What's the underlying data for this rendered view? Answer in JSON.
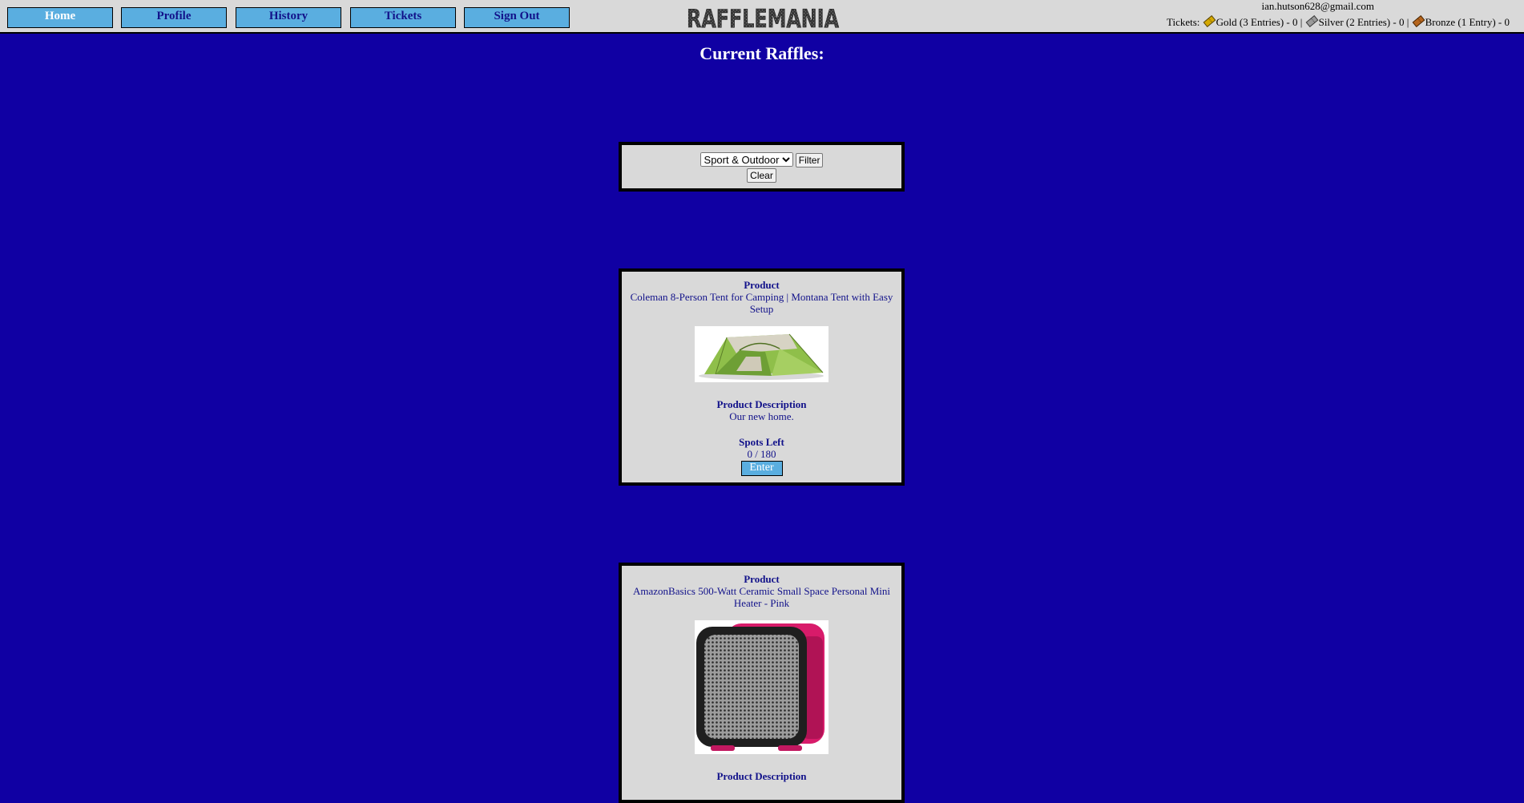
{
  "nav": {
    "home": "Home",
    "profile": "Profile",
    "history": "History",
    "tickets": "Tickets",
    "sign_out": "Sign Out"
  },
  "brand": {
    "logo_text": "RAFFLEMANIA"
  },
  "user": {
    "email": "ian.hutson628@gmail.com"
  },
  "tickets_bar": {
    "label": "Tickets:",
    "gold": "Gold (3 Entries) - 0",
    "silver": "Silver (2 Entries) - 0",
    "bronze": "Bronze (1 Entry) - 0",
    "separator": "|"
  },
  "page_title": "Current Raffles:",
  "filter": {
    "selected_category": "Sport & Outdoor",
    "filter_label": "Filter",
    "clear_label": "Clear"
  },
  "raffles": [
    {
      "product_label": "Product",
      "product_name": "Coleman 8-Person Tent for Camping | Montana Tent with Easy Setup",
      "description_label": "Product Description",
      "description": "Our new home.",
      "spots_label": "Spots Left",
      "spots": "0 / 180",
      "enter_label": "Enter"
    },
    {
      "product_label": "Product",
      "product_name": "AmazonBasics 500-Watt Ceramic Small Space Personal Mini Heater - Pink",
      "description_label": "Product Description"
    }
  ],
  "colors": {
    "background": "#1000a3",
    "header_bg": "#d9d9d9",
    "nav_button": "#5aaee0",
    "text_navy": "#12128a",
    "gold": "#d4a800",
    "silver": "#9a9a9a",
    "bronze": "#b5651d"
  },
  "icons": [
    "gold-ticket-icon",
    "silver-ticket-icon",
    "bronze-ticket-icon"
  ]
}
